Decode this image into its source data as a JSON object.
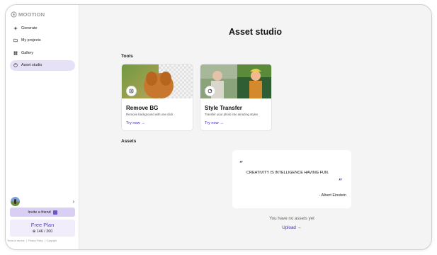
{
  "brand": {
    "name": "MOOTION"
  },
  "sidebar": {
    "items": [
      {
        "label": "Generate",
        "icon": "sparkle-icon",
        "active": false
      },
      {
        "label": "My projects",
        "icon": "folder-icon",
        "active": false
      },
      {
        "label": "Gallery",
        "icon": "grid-icon",
        "active": false
      },
      {
        "label": "Asset studio",
        "icon": "palette-icon",
        "active": true
      }
    ],
    "invite_label": "Invite a friend",
    "plan": {
      "title": "Free Plan",
      "credits": "146 / 200"
    },
    "footer": [
      "Terms of service",
      "|",
      "Privacy Policy",
      "|",
      "Copyright"
    ]
  },
  "main": {
    "title": "Asset studio",
    "tools_label": "Tools",
    "assets_label": "Assets",
    "tools": [
      {
        "title": "Remove BG",
        "desc": "Remove background with one click",
        "cta": "Try now →"
      },
      {
        "title": "Style Transfer",
        "desc": "Transfer your photo into amazing styles",
        "cta": "Try now →"
      }
    ],
    "quote": {
      "open": "“",
      "text": "CREATIVITY IS INTELLIGENCE HAVING FUN.",
      "close": "”",
      "author": "- Albert Einstein"
    },
    "empty_text": "You have no assets yet",
    "upload_label": "Upload →"
  },
  "colors": {
    "accent": "#3c2bb6",
    "active_bg": "#e7e1f7",
    "invite_bg": "#d9cff5"
  }
}
